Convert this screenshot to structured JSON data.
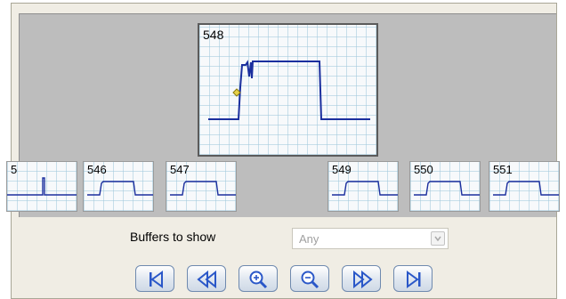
{
  "gallery": {
    "current_frame": "548",
    "thumbnails": [
      "5",
      "546",
      "547",
      "549",
      "550",
      "551"
    ]
  },
  "filter": {
    "label": "Buffers to show",
    "select_value": "Any",
    "enabled": false
  },
  "navigation": {
    "buttons": [
      "first-frame-icon",
      "previous-frame-icon",
      "zoom-in-icon",
      "zoom-out-icon",
      "next-frame-icon",
      "last-frame-icon"
    ]
  },
  "colors": {
    "waveform": "#1b2f9e",
    "marker": "#e8d24a",
    "gallery_background": "#bdbdbd",
    "panel_background": "#f0ede4"
  }
}
